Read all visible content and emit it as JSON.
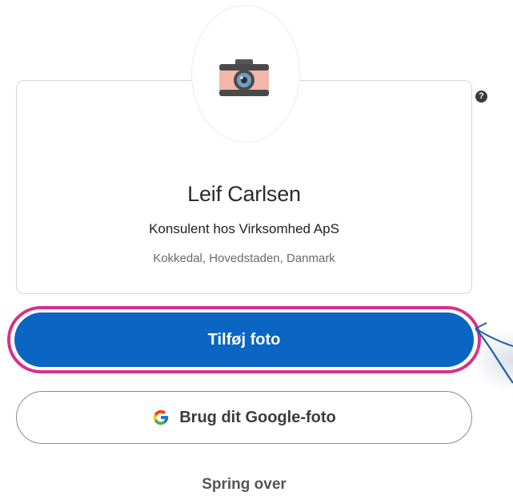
{
  "profile": {
    "name": "Leif Carlsen",
    "headline": "Konsulent hos Virksomhed ApS",
    "location": "Kokkedal, Hovedstaden, Danmark",
    "avatar_icon": "camera-icon"
  },
  "help": {
    "icon": "question-mark-icon",
    "glyph": "?"
  },
  "actions": {
    "add_photo_label": "Tilføj foto",
    "google_photo_label": "Brug dit Google-foto",
    "google_icon": "google-logo-icon",
    "skip_label": "Spring over"
  },
  "colors": {
    "primary": "#0a66c2",
    "highlight_ring": "#d92f8a",
    "pointer_arrow": "#1d5fa6",
    "camera_body": "#f2b7a8",
    "camera_top": "#4a4a4a",
    "lens": "#5d8fb0"
  }
}
